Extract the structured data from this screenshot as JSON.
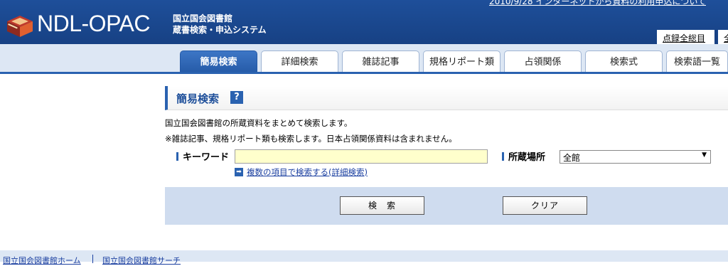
{
  "header": {
    "brand": "NDL-OPAC",
    "sub_line1": "国立国会図書館",
    "sub_line2": "蔵書検索・申込システム",
    "notice": "2010/9/28 インターネットから資料の利用申込について",
    "links": [
      "点録全総目",
      "全"
    ]
  },
  "tabs": [
    {
      "label": "簡易検索",
      "active": true
    },
    {
      "label": "詳細検索",
      "active": false
    },
    {
      "label": "雑誌記事",
      "active": false
    },
    {
      "label": "規格リポート類",
      "active": false
    },
    {
      "label": "占領関係",
      "active": false
    },
    {
      "label": "検索式",
      "active": false
    },
    {
      "label": "検索語一覧",
      "active": false
    }
  ],
  "panel": {
    "title": "簡易検索",
    "help": "?",
    "desc1": "国立国会図書館の所蔵資料をまとめて検索します。",
    "desc2": "※雑誌記事、規格リポート類も検索します。日本占領関係資料は含まれません。"
  },
  "form": {
    "keyword_label": "キーワード",
    "keyword_value": "",
    "location_label": "所蔵場所",
    "location_value": "全館",
    "advanced_link": "複数の項目で検索する(詳細検索)"
  },
  "buttons": {
    "search": "検　索",
    "clear": "クリア"
  },
  "footer": {
    "link1": "国立国会図書館ホーム",
    "link2": "国立国会図書館サーチ"
  },
  "colors": {
    "header_blue": "#1e4f9a",
    "accent": "#2a62b0",
    "keyword_bg": "#ffffcc"
  }
}
